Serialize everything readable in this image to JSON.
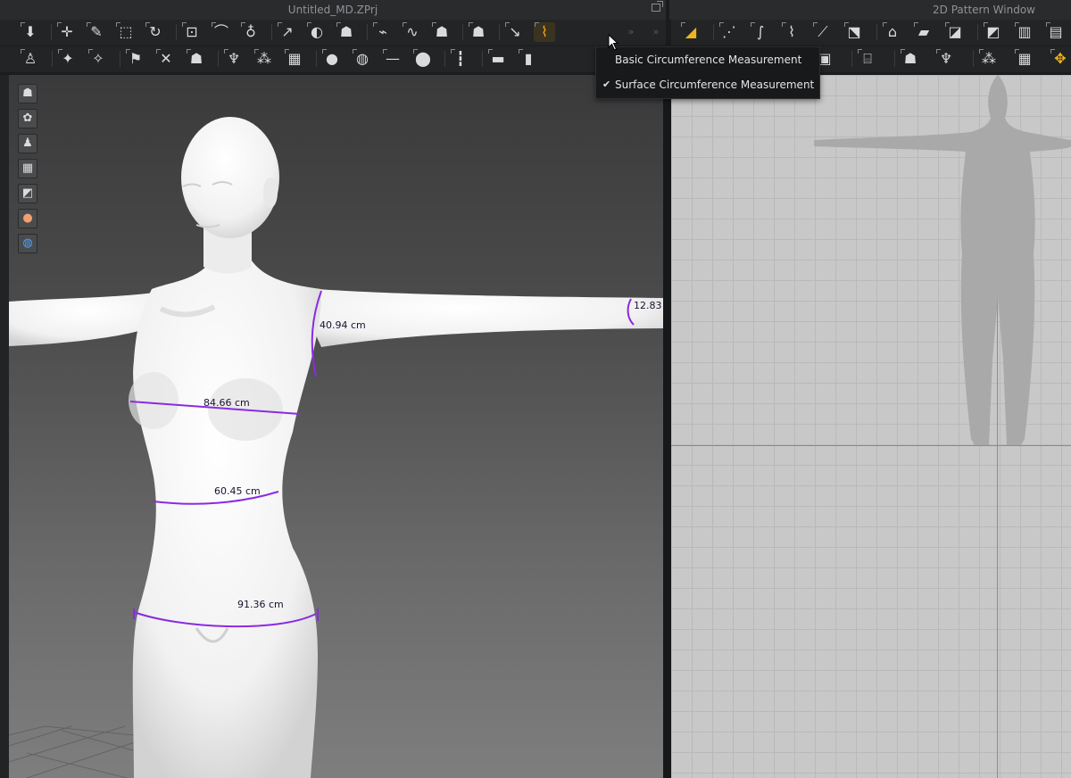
{
  "window": {
    "title_3d": "Untitled_MD.ZPrj",
    "title_2d": "2D Pattern Window"
  },
  "toolbar_3d": {
    "row1": [
      {
        "icon": "download-arrow-icon",
        "glyph": "⬇"
      },
      {
        "icon": "transform-move-icon",
        "glyph": "✛"
      },
      {
        "icon": "select-mesh-icon",
        "glyph": "✎"
      },
      {
        "icon": "bounding-box-icon",
        "glyph": "⬚"
      },
      {
        "icon": "fold-arrangement-icon",
        "glyph": "↻"
      },
      {
        "icon": "tack-icon",
        "glyph": "⊡"
      },
      {
        "icon": "tack-on-avatar-icon",
        "glyph": "⌒"
      },
      {
        "icon": "tack-pair-icon",
        "glyph": "♁"
      },
      {
        "icon": "pin-icon",
        "glyph": "↗"
      },
      {
        "icon": "fold-icon",
        "glyph": "◐"
      },
      {
        "icon": "garment-fit-icon",
        "glyph": "☗"
      },
      {
        "icon": "seam-line-icon",
        "glyph": "⌁"
      },
      {
        "icon": "stitch-icon",
        "glyph": "∿"
      },
      {
        "icon": "garment-shirt-icon",
        "glyph": "☗"
      },
      {
        "icon": "arrangement-icon",
        "glyph": "☗"
      },
      {
        "icon": "tape-measure-icon",
        "glyph": "↘"
      },
      {
        "icon": "circumference-measure-icon",
        "glyph": "⌇",
        "active": true
      }
    ],
    "row2": [
      {
        "icon": "avatar-walk-icon",
        "glyph": "♙"
      },
      {
        "icon": "avatar-pose-icon",
        "glyph": "✦"
      },
      {
        "icon": "avatar-joint-icon",
        "glyph": "✧"
      },
      {
        "icon": "avatar-arrange-icon",
        "glyph": "⚑"
      },
      {
        "icon": "avatar-measure-icon",
        "glyph": "✕"
      },
      {
        "icon": "avatar-garment-icon",
        "glyph": "☗"
      },
      {
        "icon": "hanger-icon",
        "glyph": "♆"
      },
      {
        "icon": "fabric-pattern-icon",
        "glyph": "⁂"
      },
      {
        "icon": "fabric-grid-icon",
        "glyph": "▦"
      },
      {
        "icon": "button-icon",
        "glyph": "●"
      },
      {
        "icon": "buttonhole-icon",
        "glyph": "◍"
      },
      {
        "icon": "line-tool-icon",
        "glyph": "—"
      },
      {
        "icon": "lock-icon",
        "glyph": "⬤"
      },
      {
        "icon": "zipper-icon",
        "glyph": "┇"
      },
      {
        "icon": "ruler-icon",
        "glyph": "▬"
      },
      {
        "icon": "ruler-vertical-icon",
        "glyph": "▮"
      }
    ]
  },
  "toolbar_2d": {
    "row1": [
      {
        "icon": "pattern-select-icon",
        "glyph": "◢",
        "accent": true
      },
      {
        "icon": "edit-point-icon",
        "glyph": "⋰"
      },
      {
        "icon": "curve-point-icon",
        "glyph": "∫"
      },
      {
        "icon": "edit-curvature-icon",
        "glyph": "⌇"
      },
      {
        "icon": "add-point-icon",
        "glyph": "⟋"
      },
      {
        "icon": "polygon-icon",
        "glyph": "⬔"
      },
      {
        "icon": "internal-shape-icon",
        "glyph": "⌂"
      },
      {
        "icon": "rectangle-icon",
        "glyph": "▰"
      },
      {
        "icon": "trace-icon",
        "glyph": "◪"
      },
      {
        "icon": "dart-icon",
        "glyph": "◩"
      },
      {
        "icon": "pleat-icon",
        "glyph": "▥"
      },
      {
        "icon": "gathering-icon",
        "glyph": "▤"
      }
    ],
    "row2": [
      {
        "icon": "garment-pack-icon",
        "glyph": "▣"
      },
      {
        "icon": "iron-icon",
        "glyph": "⌸"
      },
      {
        "icon": "shirt-icon",
        "glyph": "☗"
      },
      {
        "icon": "hanger-2d-icon",
        "glyph": "♆"
      },
      {
        "icon": "fabric-2d-icon",
        "glyph": "⁂"
      },
      {
        "icon": "checker-icon",
        "glyph": "▦"
      },
      {
        "icon": "move-pattern-icon",
        "glyph": "✥",
        "accent": true
      }
    ]
  },
  "dropdown": {
    "items": [
      {
        "label": "Basic Circumference Measurement",
        "checked": false
      },
      {
        "label": "Surface Circumference Measurement",
        "checked": true
      }
    ]
  },
  "side_tools": [
    {
      "icon": "garment-display-icon",
      "glyph": "☗"
    },
    {
      "icon": "fabric-render-icon",
      "glyph": "✿"
    },
    {
      "icon": "avatar-display-icon",
      "glyph": "♟"
    },
    {
      "icon": "texture-icon",
      "glyph": "▦"
    },
    {
      "icon": "mesh-icon",
      "glyph": "◩"
    },
    {
      "icon": "avatar-skin-icon",
      "glyph": "●"
    },
    {
      "icon": "globe-icon",
      "glyph": "◍"
    }
  ],
  "measurements": {
    "arm_upper": "40.94 cm",
    "wrist": "12.83",
    "bust": "84.66 cm",
    "waist": "60.45 cm",
    "hip": "91.36 cm"
  },
  "colors": {
    "measure_line": "#8a2be2",
    "accent": "#f0b41c"
  }
}
